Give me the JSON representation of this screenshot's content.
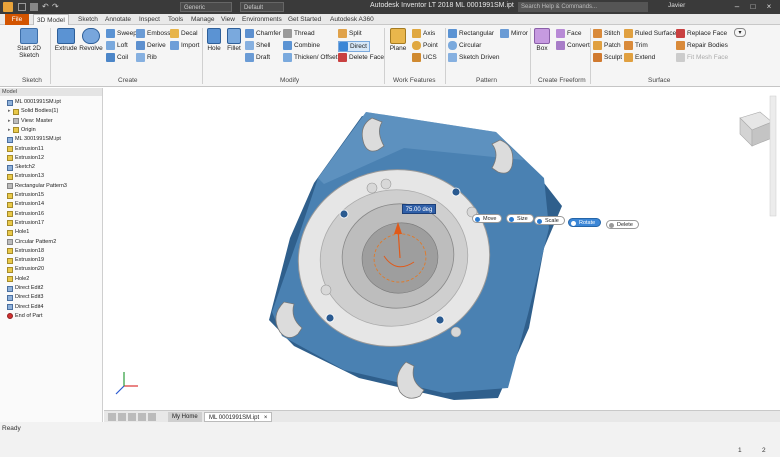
{
  "titlebar": {
    "title": "Autodesk Inventor LT 2018   ML 0001991SM.ipt",
    "search_placeholder": "Search Help & Commands...",
    "user": "Javier",
    "material_dropdown": "Generic",
    "appearance_dropdown": "Default"
  },
  "tabs": [
    "File",
    "3D Model",
    "Sketch",
    "Annotate",
    "Inspect",
    "Tools",
    "Manage",
    "View",
    "Environments",
    "Get Started",
    "Autodesk A360"
  ],
  "ribbon": {
    "sketch": {
      "start": "Start 2D Sketch",
      "label": "Sketch"
    },
    "create": {
      "extrude": "Extrude",
      "revolve": "Revolve",
      "sweep": "Sweep",
      "loft": "Loft",
      "coil": "Coil",
      "emboss": "Emboss",
      "derive": "Derive",
      "rib": "Rib",
      "decal": "Decal",
      "import": "Import",
      "label": "Create"
    },
    "modify": {
      "hole": "Hole",
      "fillet": "Fillet",
      "chamfer": "Chamfer",
      "shell": "Shell",
      "draft": "Draft",
      "thread": "Thread",
      "combine": "Combine",
      "thicken": "Thicken/ Offset",
      "split": "Split",
      "direct": "Direct",
      "delete_face": "Delete Face",
      "label": "Modify"
    },
    "work": {
      "plane": "Plane",
      "axis": "Axis",
      "point": "Point",
      "ucs": "UCS",
      "label": "Work Features"
    },
    "pattern": {
      "rectangular": "Rectangular",
      "circular": "Circular",
      "sketch_driven": "Sketch Driven",
      "mirror": "Mirror",
      "label": "Pattern"
    },
    "freeform": {
      "box": "Box",
      "face": "Face",
      "convert": "Convert",
      "label": "Create Freeform"
    },
    "surface": {
      "stitch": "Stitch",
      "patch": "Patch",
      "sculpt": "Sculpt",
      "ruled": "Ruled Surface",
      "trim": "Trim",
      "extend": "Extend",
      "replace": "Replace Face",
      "repair": "Repair Bodies",
      "fix_mesh": "Fit Mesh Face",
      "label": "Surface"
    }
  },
  "browser": {
    "header": "Model",
    "items": [
      {
        "label": "ML 0001991SM.ipt",
        "icon": "part"
      },
      {
        "label": "Solid Bodies(1)",
        "icon": "folder"
      },
      {
        "label": "View: Master",
        "icon": "view"
      },
      {
        "label": "Origin",
        "icon": "folder"
      },
      {
        "label": "ML 3001991SM.ipt",
        "icon": "part"
      },
      {
        "label": "Extrusion11",
        "icon": "feature"
      },
      {
        "label": "Extrusion12",
        "icon": "feature"
      },
      {
        "label": "Sketch2",
        "icon": "sketch"
      },
      {
        "label": "Extrusion13",
        "icon": "feature"
      },
      {
        "label": "Rectangular Pattern3",
        "icon": "pattern"
      },
      {
        "label": "Extrusion15",
        "icon": "feature"
      },
      {
        "label": "Extrusion14",
        "icon": "feature"
      },
      {
        "label": "Extrusion16",
        "icon": "feature"
      },
      {
        "label": "Extrusion17",
        "icon": "feature"
      },
      {
        "label": "Hole1",
        "icon": "feature"
      },
      {
        "label": "Circular Pattern2",
        "icon": "pattern"
      },
      {
        "label": "Extrusion18",
        "icon": "feature"
      },
      {
        "label": "Extrusion19",
        "icon": "feature"
      },
      {
        "label": "Extrusion20",
        "icon": "feature"
      },
      {
        "label": "Hole2",
        "icon": "feature"
      },
      {
        "label": "Direct Edit2",
        "icon": "direct"
      },
      {
        "label": "Direct Edit3",
        "icon": "direct"
      },
      {
        "label": "Direct Edit4",
        "icon": "direct"
      },
      {
        "label": "End of Part",
        "icon": "end"
      }
    ]
  },
  "viewport": {
    "angle_value": "75.00 deg",
    "move": "Move",
    "size": "Size",
    "scale": "Scale",
    "rotate": "Rotate",
    "delete": "Delete"
  },
  "doctabs": {
    "home": "My Home",
    "doc": "ML 0001991SM.ipt"
  },
  "status": {
    "text": "Ready",
    "num1": "1",
    "num2": "2"
  },
  "colors": {
    "accent": "#d35400",
    "part_blue": "#4a7fae",
    "face_white": "#e6e6e6"
  }
}
